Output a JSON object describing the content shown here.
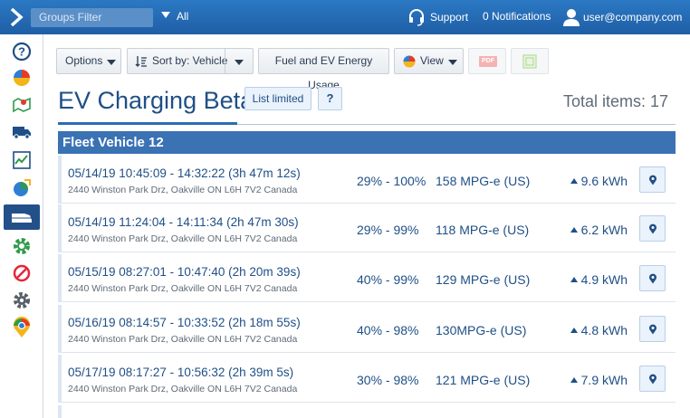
{
  "topbar": {
    "filter_placeholder": "Groups Filter",
    "filter_value": "All",
    "support_label": "Support",
    "notifications_label": "0 Notifications",
    "user_label": "user@company.com"
  },
  "toolbar": {
    "options_label": "Options",
    "sort_label": "Sort by: Vehicle",
    "report_label": "Fuel and EV Energy Usage",
    "view_label": "View",
    "pdf_label": "PDF"
  },
  "header": {
    "title": "EV Charging Beta",
    "list_limited_label": "List limited",
    "help_label": "?",
    "total_items": "Total items: 17"
  },
  "group": {
    "name": "Fleet Vehicle 12"
  },
  "rows": [
    {
      "date": "05/14/19 10:45:09 - 14:32:22 (3h 47m 12s)",
      "address": "2440 Winston Park Drz, Oakville ON L6H 7V2 Canada",
      "charge": "29% - 100%",
      "mpg": "158 MPG-e (US)",
      "kwh": "9.6 kWh"
    },
    {
      "date": "05/14/19 11:24:04 - 14:11:34 (2h 47m 30s)",
      "address": "2440 Winston Park Drz, Oakville ON L6H 7V2 Canada",
      "charge": "29% - 99%",
      "mpg": "118 MPG-e (US)",
      "kwh": "6.2 kWh"
    },
    {
      "date": "05/15/19 08:27:01 - 10:47:40 (2h 20m 39s)",
      "address": "2440 Winston Park Drz, Oakville ON L6H 7V2 Canada",
      "charge": "40% - 99%",
      "mpg": "129 MPG-e (US)",
      "kwh": "4.9 kWh"
    },
    {
      "date": "05/16/19 08:14:57 - 10:33:52 (2h 18m 55s)",
      "address": "2440 Winston Park Drz, Oakville ON L6H 7V2 Canada",
      "charge": "40% - 98%",
      "mpg": "130MPG-e (US)",
      "kwh": "4.8 kWh"
    },
    {
      "date": "05/17/19 08:17:27 - 10:56:32 (2h 39m 5s)",
      "address": "2440 Winston Park Drz, Oakville ON L6H 7V2 Canada",
      "charge": "30% - 98%",
      "mpg": "121 MPG-e (US)",
      "kwh": "7.9 kWh"
    }
  ],
  "sidebar": {
    "icons": [
      "help-icon",
      "dashboard-pie-icon",
      "map-icon",
      "vehicle-truck-icon",
      "activity-chart-icon",
      "engine-pie-icon",
      "ev-vehicle-icon",
      "rules-gear-icon",
      "exceptions-block-icon",
      "settings-gear-icon",
      "marketplace-pin-icon"
    ]
  },
  "colors": {
    "topbar": "#2570b9",
    "accent": "#1f4f86",
    "group_header": "#3a72b4",
    "active_nav": "#24508a"
  }
}
